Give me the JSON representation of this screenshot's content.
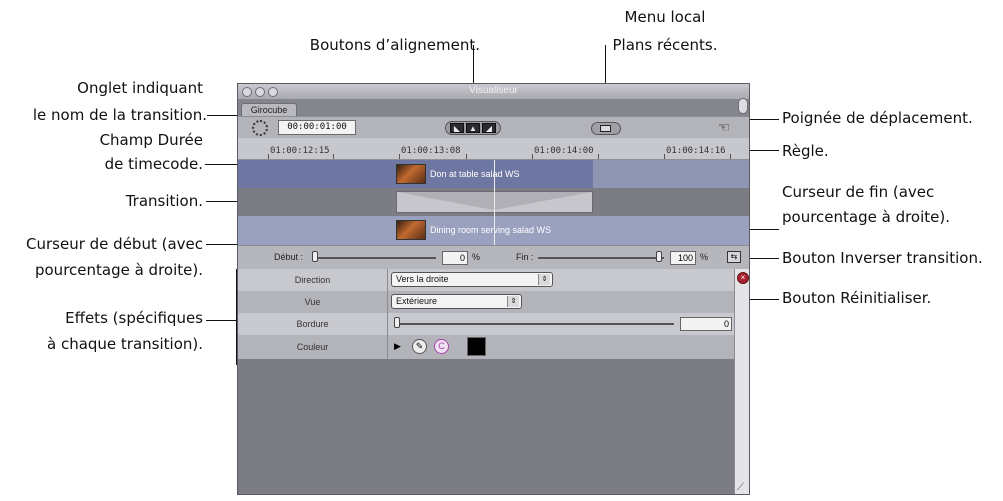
{
  "window": {
    "title": "Visualiseur",
    "tab_label": "Girocube",
    "timecode": "00:00:01:00",
    "align_buttons": [
      "◣",
      "▲",
      "◢"
    ],
    "ruler_labels": [
      "01:00:12:15",
      "01:00:13:08",
      "01:00:14:00",
      "01:00:14:16"
    ]
  },
  "tracks": {
    "clip_a": "Don at table salad WS",
    "clip_b": "Dining room serving salad WS"
  },
  "sliders": {
    "start_label": "Début :",
    "start_value": "0",
    "start_fraction": 0.0,
    "end_label": "Fin :",
    "end_value": "100",
    "end_fraction": 1.0,
    "percent_sign": "%"
  },
  "parameters": [
    {
      "name": "Direction",
      "value": "Vers la droite"
    },
    {
      "name": "Vue",
      "value": "Extérieure"
    },
    {
      "name": "Bordure",
      "value": "0",
      "slider_fraction": 0.0
    },
    {
      "name": "Couleur",
      "swatch": "#000000"
    }
  ],
  "callouts": {
    "align": "Boutons d’alignement.",
    "local_menu_1": "Menu local",
    "local_menu_2": "Plans récents.",
    "tab_1": "Onglet indiquant",
    "tab_2": "le nom de la transition.",
    "duration_1": "Champ Durée",
    "duration_2": "de timecode.",
    "transition": "Transition.",
    "start_1": "Curseur de début (avec",
    "start_2": "pourcentage à droite).",
    "effects_1": "Effets (spécifiques",
    "effects_2": "à chaque transition).",
    "drag_handle": "Poignée de déplacement.",
    "ruler": "Règle.",
    "end_1": "Curseur de fin (avec",
    "end_2": "pourcentage à droite).",
    "reverse": "Bouton Inverser transition.",
    "reset": "Bouton Réinitialiser."
  },
  "icons": {
    "clock": "clock-icon",
    "recent_clips": "recent-clips-menu-icon",
    "drag_handle": "hand-icon",
    "reverse": "reverse-transition-icon",
    "reset": "reset-x-icon",
    "color_picker": "eyedropper-icon",
    "color_wheel": "color-wheel-icon"
  },
  "colors": {
    "window_bg": "#7b7c84",
    "track_a": "#6e77a1",
    "track_b": "#9aa1bf",
    "transition_block": "#c6c6cc",
    "color_swatch": "#000000"
  }
}
